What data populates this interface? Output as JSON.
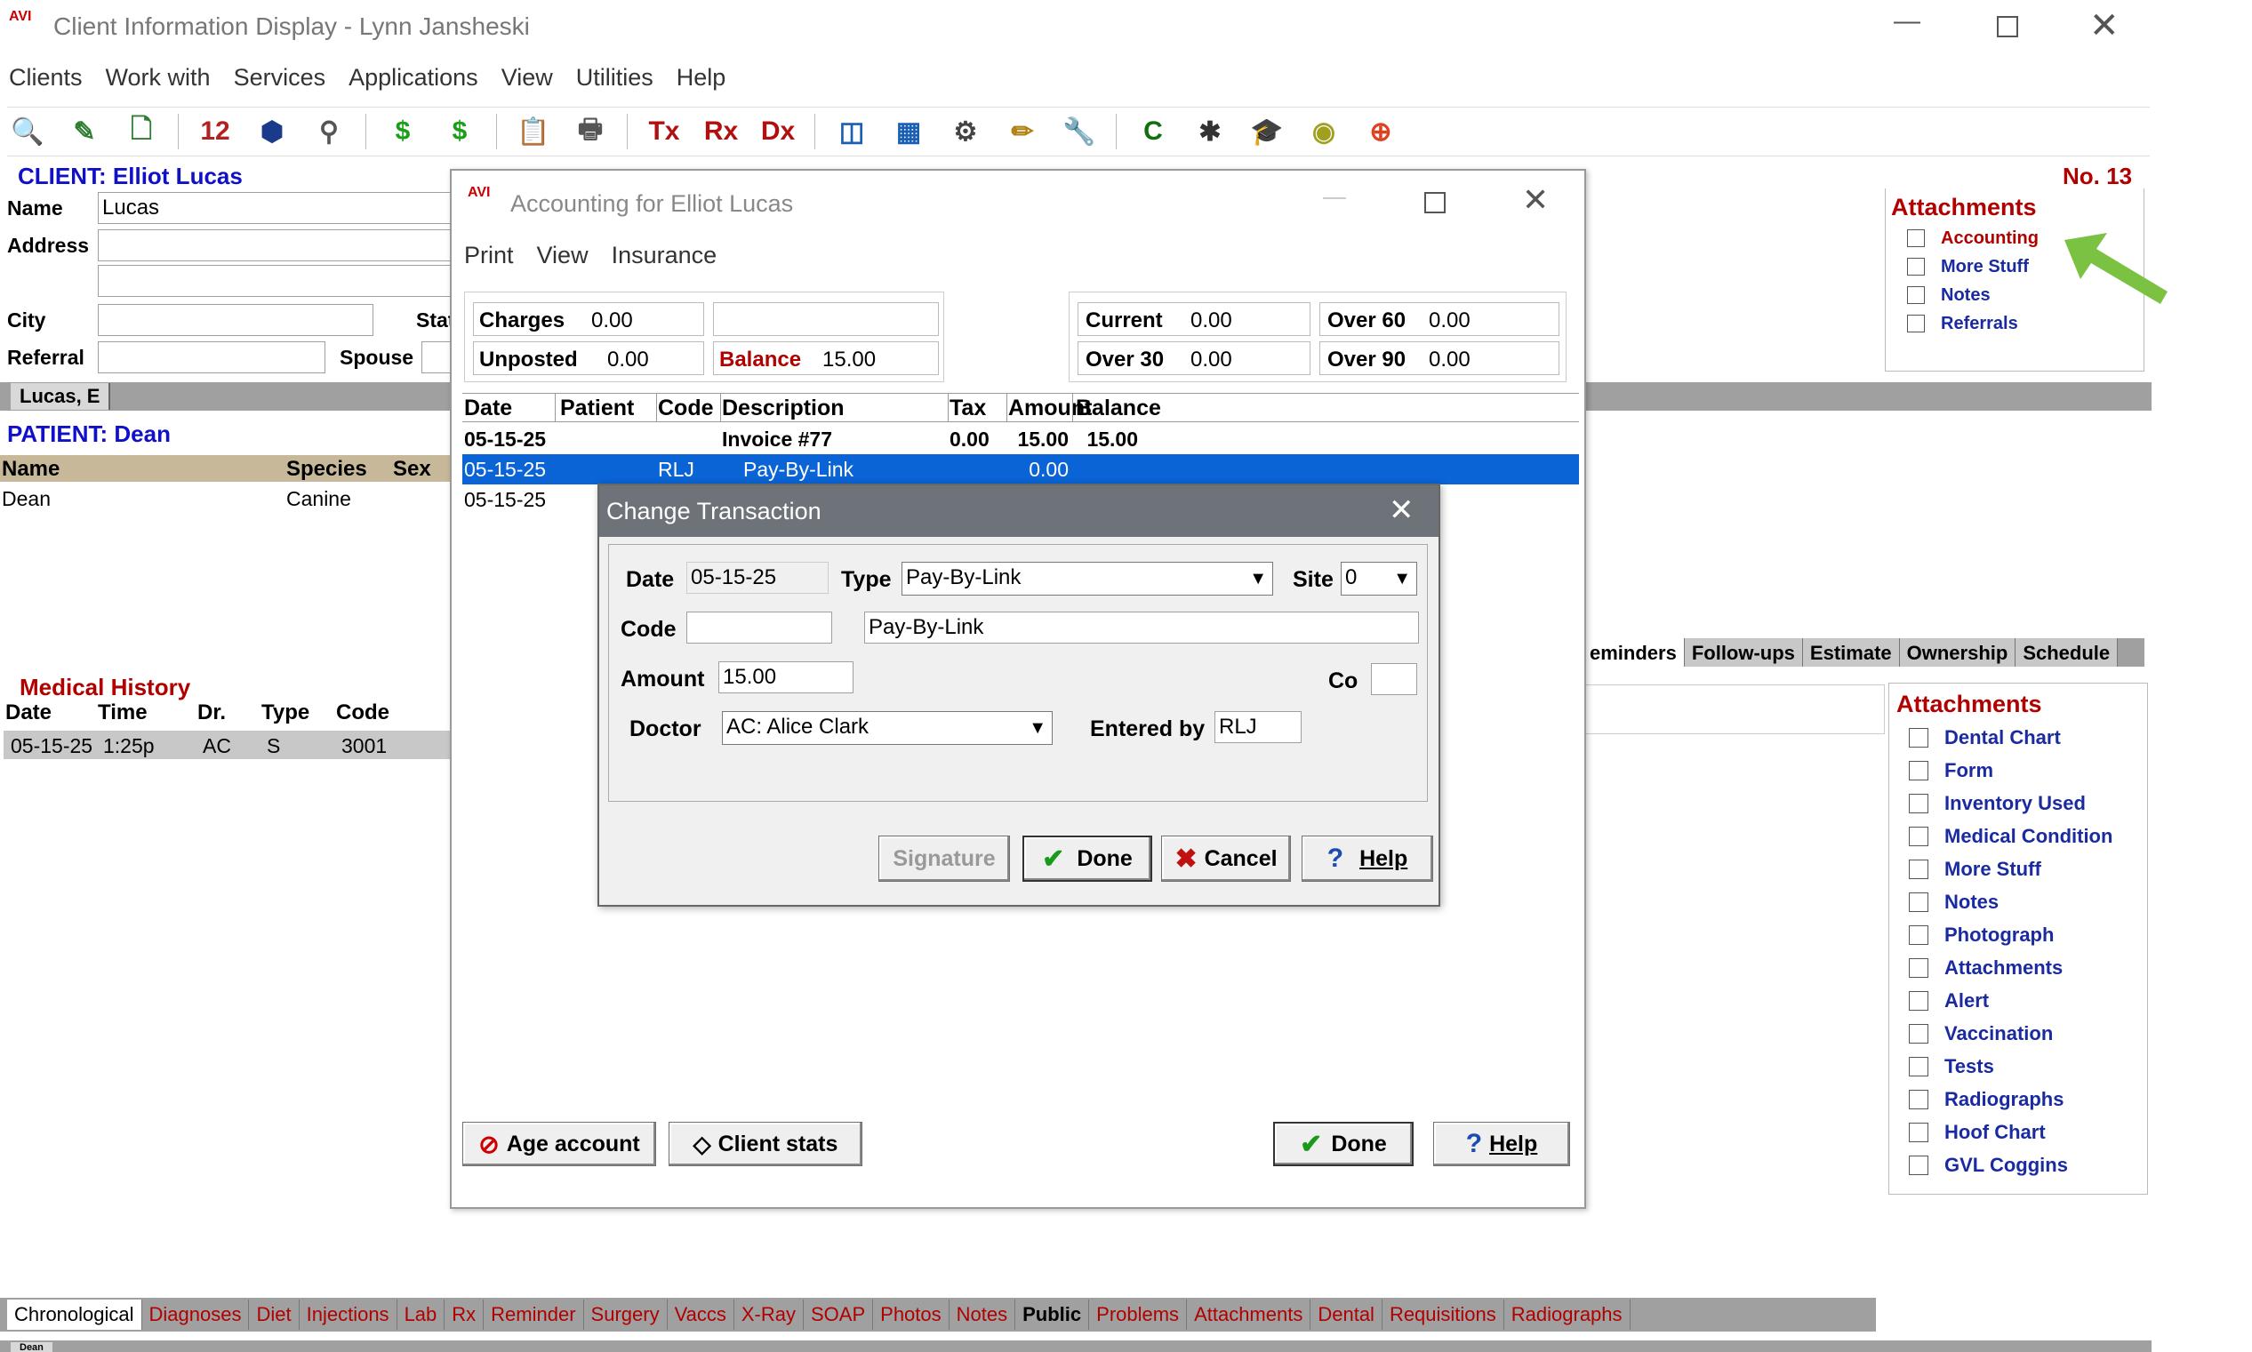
{
  "window": {
    "logo": "AVI",
    "title": "Client Information Display - Lynn Jansheski"
  },
  "menu": [
    "Clients",
    "Work with",
    "Services",
    "Applications",
    "View",
    "Utilities",
    "Help"
  ],
  "toolbar": [
    {
      "icon": "search-icon",
      "glyph": "🔍",
      "color": "#1a5fb4"
    },
    {
      "icon": "edit-icon",
      "glyph": "✎",
      "color": "#2f7d32"
    },
    {
      "icon": "new-document-icon",
      "glyph": "🗋",
      "color": "#2f7d32"
    },
    {
      "icon": "calendar-icon",
      "glyph": "12",
      "color": "#b22222"
    },
    {
      "icon": "box-icon",
      "glyph": "⬢",
      "color": "#1a3a8a"
    },
    {
      "icon": "pin-icon",
      "glyph": "⚲",
      "color": "#555"
    },
    {
      "icon": "dollar-icon",
      "glyph": "$",
      "color": "#18a018"
    },
    {
      "icon": "dollar-add-icon",
      "glyph": "$",
      "color": "#18a018"
    },
    {
      "icon": "clipboard-icon",
      "glyph": "📋",
      "color": "#a06010"
    },
    {
      "icon": "printer-icon",
      "glyph": "🖶",
      "color": "#555"
    },
    {
      "icon": "tx-icon",
      "glyph": "Tx",
      "color": "#b01010"
    },
    {
      "icon": "rx-icon",
      "glyph": "Rx",
      "color": "#b01010"
    },
    {
      "icon": "dx-icon",
      "glyph": "Dx",
      "color": "#b01010"
    },
    {
      "icon": "preview-icon",
      "glyph": "◫",
      "color": "#1a5fb4"
    },
    {
      "icon": "calculator-icon",
      "glyph": "▦",
      "color": "#1a5fb4"
    },
    {
      "icon": "tools-icon",
      "glyph": "⚙",
      "color": "#444"
    },
    {
      "icon": "pencil-icon",
      "glyph": "✏",
      "color": "#b08010"
    },
    {
      "icon": "wrench-icon",
      "glyph": "🔧",
      "color": "#777"
    },
    {
      "icon": "cc-icon",
      "glyph": "C",
      "color": "#107010"
    },
    {
      "icon": "bug-icon",
      "glyph": "✱",
      "color": "#333"
    },
    {
      "icon": "graduation-icon",
      "glyph": "🎓",
      "color": "#600"
    },
    {
      "icon": "seal-icon",
      "glyph": "◉",
      "color": "#a0a020"
    },
    {
      "icon": "lifebuoy-icon",
      "glyph": "⊕",
      "color": "#e04020"
    }
  ],
  "client": {
    "header": "CLIENT:",
    "name": "Elliot Lucas",
    "number": "No. 13",
    "name_label": "Name",
    "name_value": "Lucas",
    "address_label": "Address",
    "city_label": "City",
    "state_label": "Stat",
    "referral_label": "Referral",
    "spouse_label": "Spouse",
    "tab": "Lucas, E"
  },
  "client_attachments": {
    "title": "Attachments",
    "items": [
      "Accounting",
      "More Stuff",
      "Notes",
      "Referrals"
    ]
  },
  "patient": {
    "header": "PATIENT:",
    "name": "Dean",
    "col_name": "Name",
    "col_species": "Species",
    "col_sex": "Sex",
    "row_name": "Dean",
    "row_species": "Canine",
    "tab": "Dean"
  },
  "medical_history": {
    "title": "Medical History",
    "cols": [
      "Date",
      "Time",
      "Dr.",
      "Type",
      "Code"
    ],
    "row": [
      "05-15-25",
      "1:25p",
      "AC",
      "S",
      "3001"
    ]
  },
  "right_tabs": [
    "eminders",
    "Follow-ups",
    "Estimate",
    "Ownership",
    "Schedule"
  ],
  "patient_attachments": {
    "title": "Attachments",
    "items": [
      "Dental Chart",
      "Form",
      "Inventory Used",
      "Medical Condition",
      "More Stuff",
      "Notes",
      "Photograph",
      "Attachments",
      "Alert",
      "Vaccination",
      "Tests",
      "Radiographs",
      "Hoof Chart",
      "GVL Coggins"
    ]
  },
  "bottom_tabs": [
    "Chronological",
    "Diagnoses",
    "Diet",
    "Injections",
    "Lab",
    "Rx",
    "Reminder",
    "Surgery",
    "Vaccs",
    "X-Ray",
    "SOAP",
    "Photos",
    "Notes",
    "Public",
    "Problems",
    "Attachments",
    "Dental",
    "Requisitions",
    "Radiographs"
  ],
  "accounting": {
    "logo": "AVI",
    "title": "Accounting for Elliot Lucas",
    "menu": [
      "Print",
      "View",
      "Insurance"
    ],
    "charges_label": "Charges",
    "charges": "0.00",
    "unposted_label": "Unposted",
    "unposted": "0.00",
    "balance_label": "Balance",
    "balance": "15.00",
    "current_label": "Current",
    "current": "0.00",
    "over60_label": "Over 60",
    "over60": "0.00",
    "over30_label": "Over 30",
    "over30": "0.00",
    "over90_label": "Over 90",
    "over90": "0.00",
    "cols": [
      "Date",
      "Patient",
      "Code",
      "Description",
      "Tax",
      "Amount",
      "Balance"
    ],
    "rows": [
      {
        "date": "05-15-25",
        "patient": "",
        "code": "",
        "desc": "Invoice #77",
        "tax": "0.00",
        "amount": "15.00",
        "balance": "15.00"
      },
      {
        "date": "05-15-25",
        "patient": "",
        "code": "RLJ",
        "desc": "Pay-By-Link",
        "tax": "",
        "amount": "0.00",
        "balance": ""
      },
      {
        "date": "05-15-25",
        "patient": "",
        "code": "",
        "desc": "",
        "tax": "",
        "amount": "",
        "balance": ""
      }
    ],
    "age_button": "Age account",
    "stats_button": "Client stats",
    "done_button": "Done",
    "help_button": "Help"
  },
  "change": {
    "title": "Change Transaction",
    "date_label": "Date",
    "date": "05-15-25",
    "type_label": "Type",
    "type": "Pay-By-Link",
    "site_label": "Site",
    "site": "0",
    "code_label": "Code",
    "code": "",
    "desc": "Pay-By-Link",
    "amount_label": "Amount",
    "amount": "15.00",
    "co_label": "Co",
    "co": "",
    "doctor_label": "Doctor",
    "doctor": "AC: Alice Clark",
    "entered_label": "Entered by",
    "entered": "RLJ",
    "signature_button": "Signature",
    "done_button": "Done",
    "cancel_button": "Cancel",
    "help_button": "Help"
  }
}
